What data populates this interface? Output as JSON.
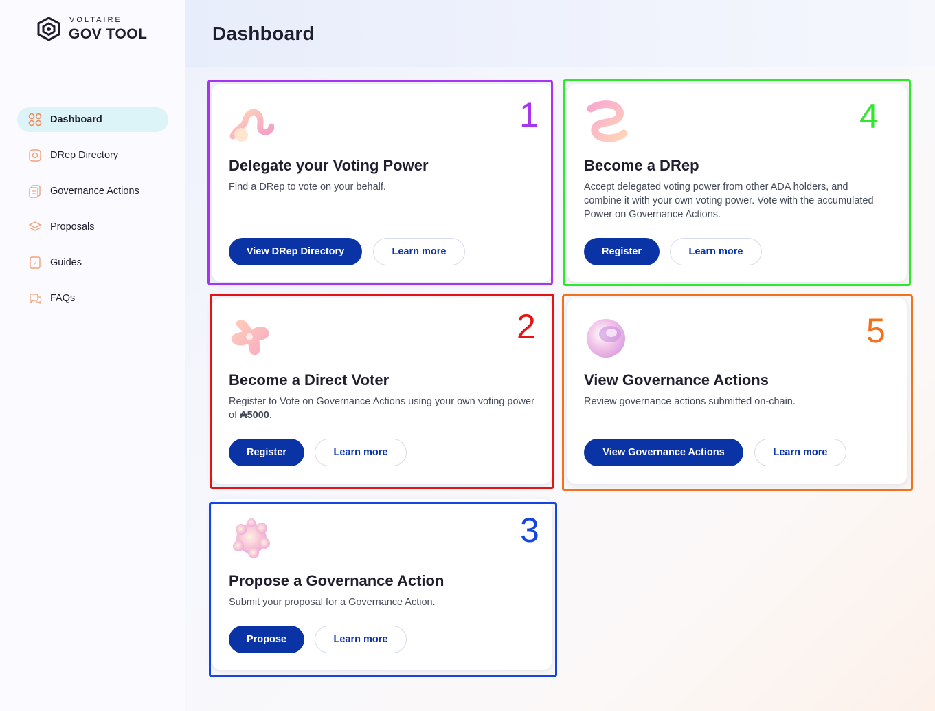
{
  "app": {
    "logo_sub": "VOLTAIRE",
    "logo_main": "GOV TOOL"
  },
  "sidebar": {
    "items": [
      {
        "label": "Dashboard",
        "icon": "dashboard-grid-icon",
        "active": true
      },
      {
        "label": "DRep Directory",
        "icon": "drep-directory-icon",
        "active": false
      },
      {
        "label": "Governance Actions",
        "icon": "governance-actions-icon",
        "active": false
      },
      {
        "label": "Proposals",
        "icon": "proposals-icon",
        "active": false
      },
      {
        "label": "Guides",
        "icon": "guides-icon",
        "active": false
      },
      {
        "label": "FAQs",
        "icon": "faqs-icon",
        "active": false
      }
    ]
  },
  "header": {
    "title": "Dashboard"
  },
  "cards": {
    "delegate": {
      "title": "Delegate your Voting Power",
      "description": "Find a DRep to vote on your behalf.",
      "primary_label": "View DRep Directory",
      "secondary_label": "Learn more",
      "annotation": "1"
    },
    "direct_voter": {
      "title": "Become a Direct Voter",
      "description_pre": "Register to Vote on Governance Actions using your own voting power of ",
      "description_amount": "₳5000",
      "description_post": ".",
      "primary_label": "Register",
      "secondary_label": "Learn more",
      "annotation": "2"
    },
    "propose": {
      "title": "Propose a Governance Action",
      "description": "Submit your proposal for a Governance Action.",
      "primary_label": "Propose",
      "secondary_label": "Learn more",
      "annotation": "3"
    },
    "drep": {
      "title": "Become a DRep",
      "description": "Accept delegated voting power from other ADA holders, and combine it with your own voting power. Vote with the accumulated Power on Governance Actions.",
      "primary_label": "Register",
      "secondary_label": "Learn more",
      "annotation": "4"
    },
    "governance": {
      "title": "View Governance Actions",
      "description": "Review governance actions submitted on-chain.",
      "primary_label": "View Governance Actions",
      "secondary_label": "Learn more",
      "annotation": "5"
    }
  },
  "colors": {
    "primary": "#0a33a6",
    "annotation_1": "#a634f0",
    "annotation_2": "#e41414",
    "annotation_3": "#1545e0",
    "annotation_4": "#2ee82a",
    "annotation_5": "#f2711c"
  }
}
